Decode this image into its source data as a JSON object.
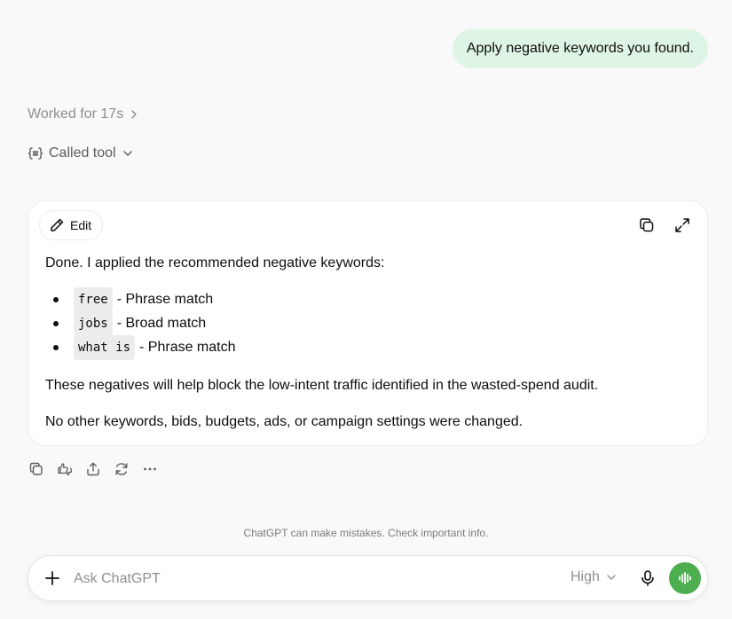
{
  "user_message": "Apply negative keywords you found.",
  "status": {
    "worked": "Worked for 17s",
    "called_tool": "Called tool"
  },
  "response": {
    "edit_label": "Edit",
    "intro": "Done. I applied the recommended negative keywords:",
    "keywords": [
      {
        "term": "free",
        "match": "- Phrase match"
      },
      {
        "term": "jobs",
        "match": "- Broad match"
      },
      {
        "term": "what is",
        "match": "- Phrase match"
      }
    ],
    "paragraph_1": "These negatives will help block the low-intent traffic identified in the wasted-spend audit.",
    "paragraph_2": "No other keywords, bids, budgets, ads, or campaign settings were changed."
  },
  "actions": [
    "copy-icon",
    "thumbs-icon",
    "share-icon",
    "regenerate-icon",
    "more-icon"
  ],
  "disclaimer": "ChatGPT can make mistakes. Check important info.",
  "composer": {
    "placeholder": "Ask ChatGPT",
    "model": "High"
  },
  "colors": {
    "user_bubble": "#def4e4",
    "voice_button": "#4cae4f",
    "background": "#f9f9f9"
  }
}
